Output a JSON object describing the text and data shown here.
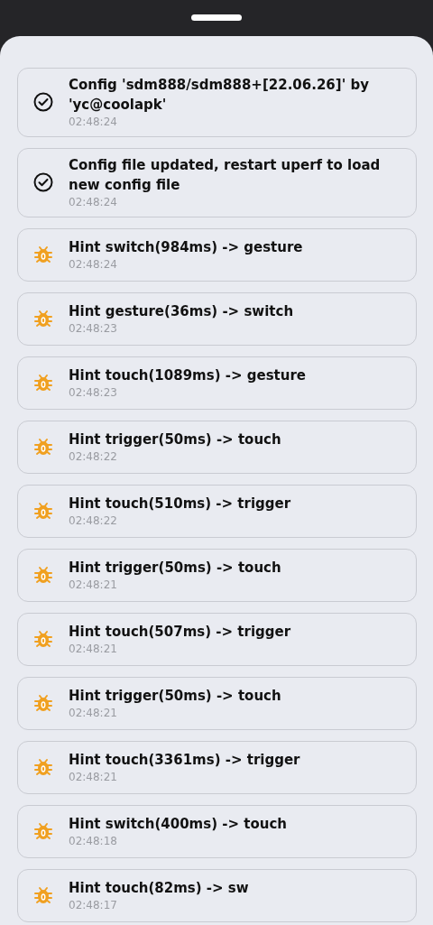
{
  "entries": [
    {
      "kind": "success",
      "message": "Config 'sdm888/sdm888+[22.06.26]' by 'yc@coolapk'",
      "time": "02:48:24"
    },
    {
      "kind": "success",
      "message": "Config file updated, restart uperf to load new config file",
      "time": "02:48:24"
    },
    {
      "kind": "hint",
      "message": "Hint switch(984ms) -> gesture",
      "time": "02:48:24"
    },
    {
      "kind": "hint",
      "message": "Hint gesture(36ms) -> switch",
      "time": "02:48:23"
    },
    {
      "kind": "hint",
      "message": "Hint touch(1089ms) -> gesture",
      "time": "02:48:23"
    },
    {
      "kind": "hint",
      "message": "Hint trigger(50ms) -> touch",
      "time": "02:48:22"
    },
    {
      "kind": "hint",
      "message": "Hint touch(510ms) -> trigger",
      "time": "02:48:22"
    },
    {
      "kind": "hint",
      "message": "Hint trigger(50ms) -> touch",
      "time": "02:48:21"
    },
    {
      "kind": "hint",
      "message": "Hint touch(507ms) -> trigger",
      "time": "02:48:21"
    },
    {
      "kind": "hint",
      "message": "Hint trigger(50ms) -> touch",
      "time": "02:48:21"
    },
    {
      "kind": "hint",
      "message": "Hint touch(3361ms) -> trigger",
      "time": "02:48:21"
    },
    {
      "kind": "hint",
      "message": "Hint switch(400ms) -> touch",
      "time": "02:48:18"
    },
    {
      "kind": "hint",
      "message": "Hint touch(82ms) -> sw",
      "time": "02:48:17"
    }
  ]
}
